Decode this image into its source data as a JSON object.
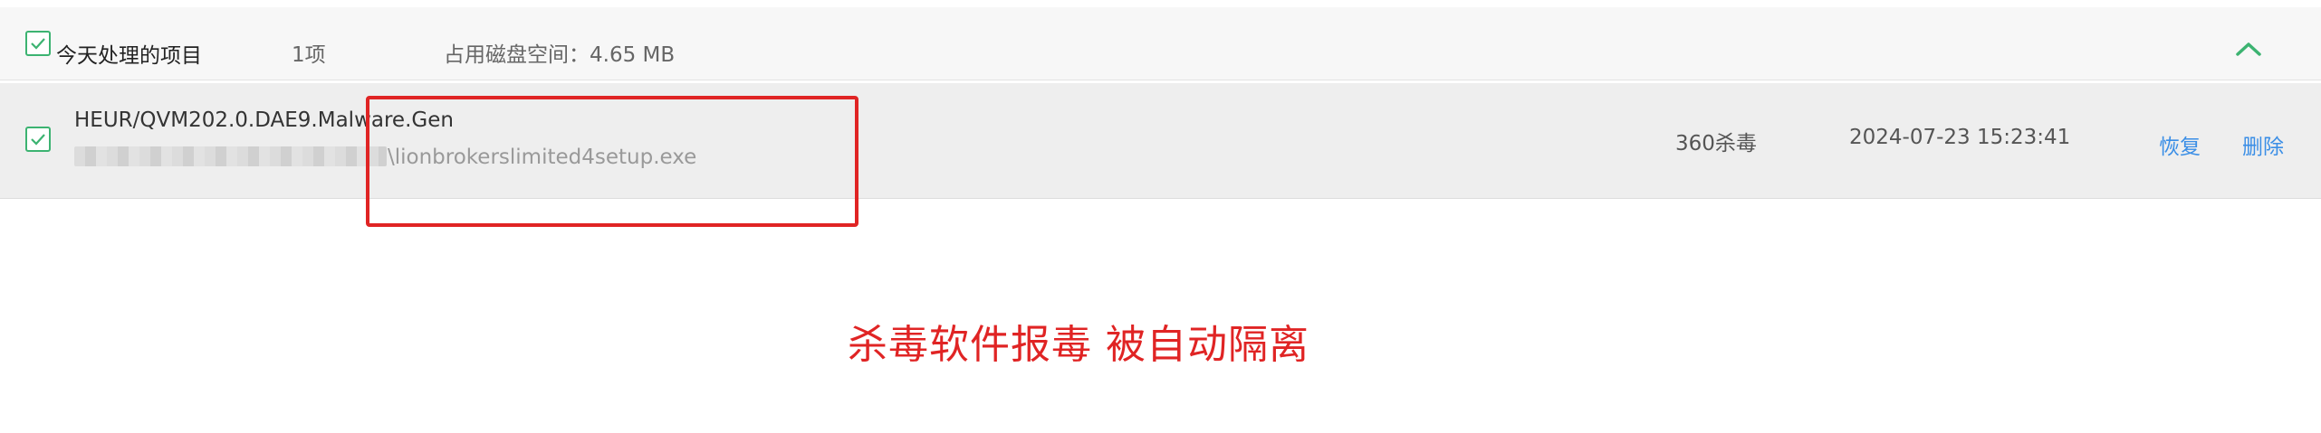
{
  "group": {
    "title": "今天处理的项目",
    "count": "1项",
    "disk_usage": "占用磁盘空间：4.65 MB",
    "checked": true,
    "collapse_icon": "chevron-up-icon"
  },
  "items": [
    {
      "threat_name": "HEUR/QVM202.0.DAE9.Malware.Gen",
      "file_path_visible": "\\lionbrokerslimited4setup.exe",
      "engine": "360杀毒",
      "datetime": "2024-07-23 15:23:41",
      "restore_label": "恢复",
      "delete_label": "删除",
      "checked": true
    }
  ],
  "annotation": {
    "text": "杀毒软件报毒 被自动隔离"
  },
  "colors": {
    "accent_green": "#3cb371",
    "link_blue": "#3a8ee6",
    "annotation_red": "#e02424",
    "row_bg": "#eeeeee"
  }
}
